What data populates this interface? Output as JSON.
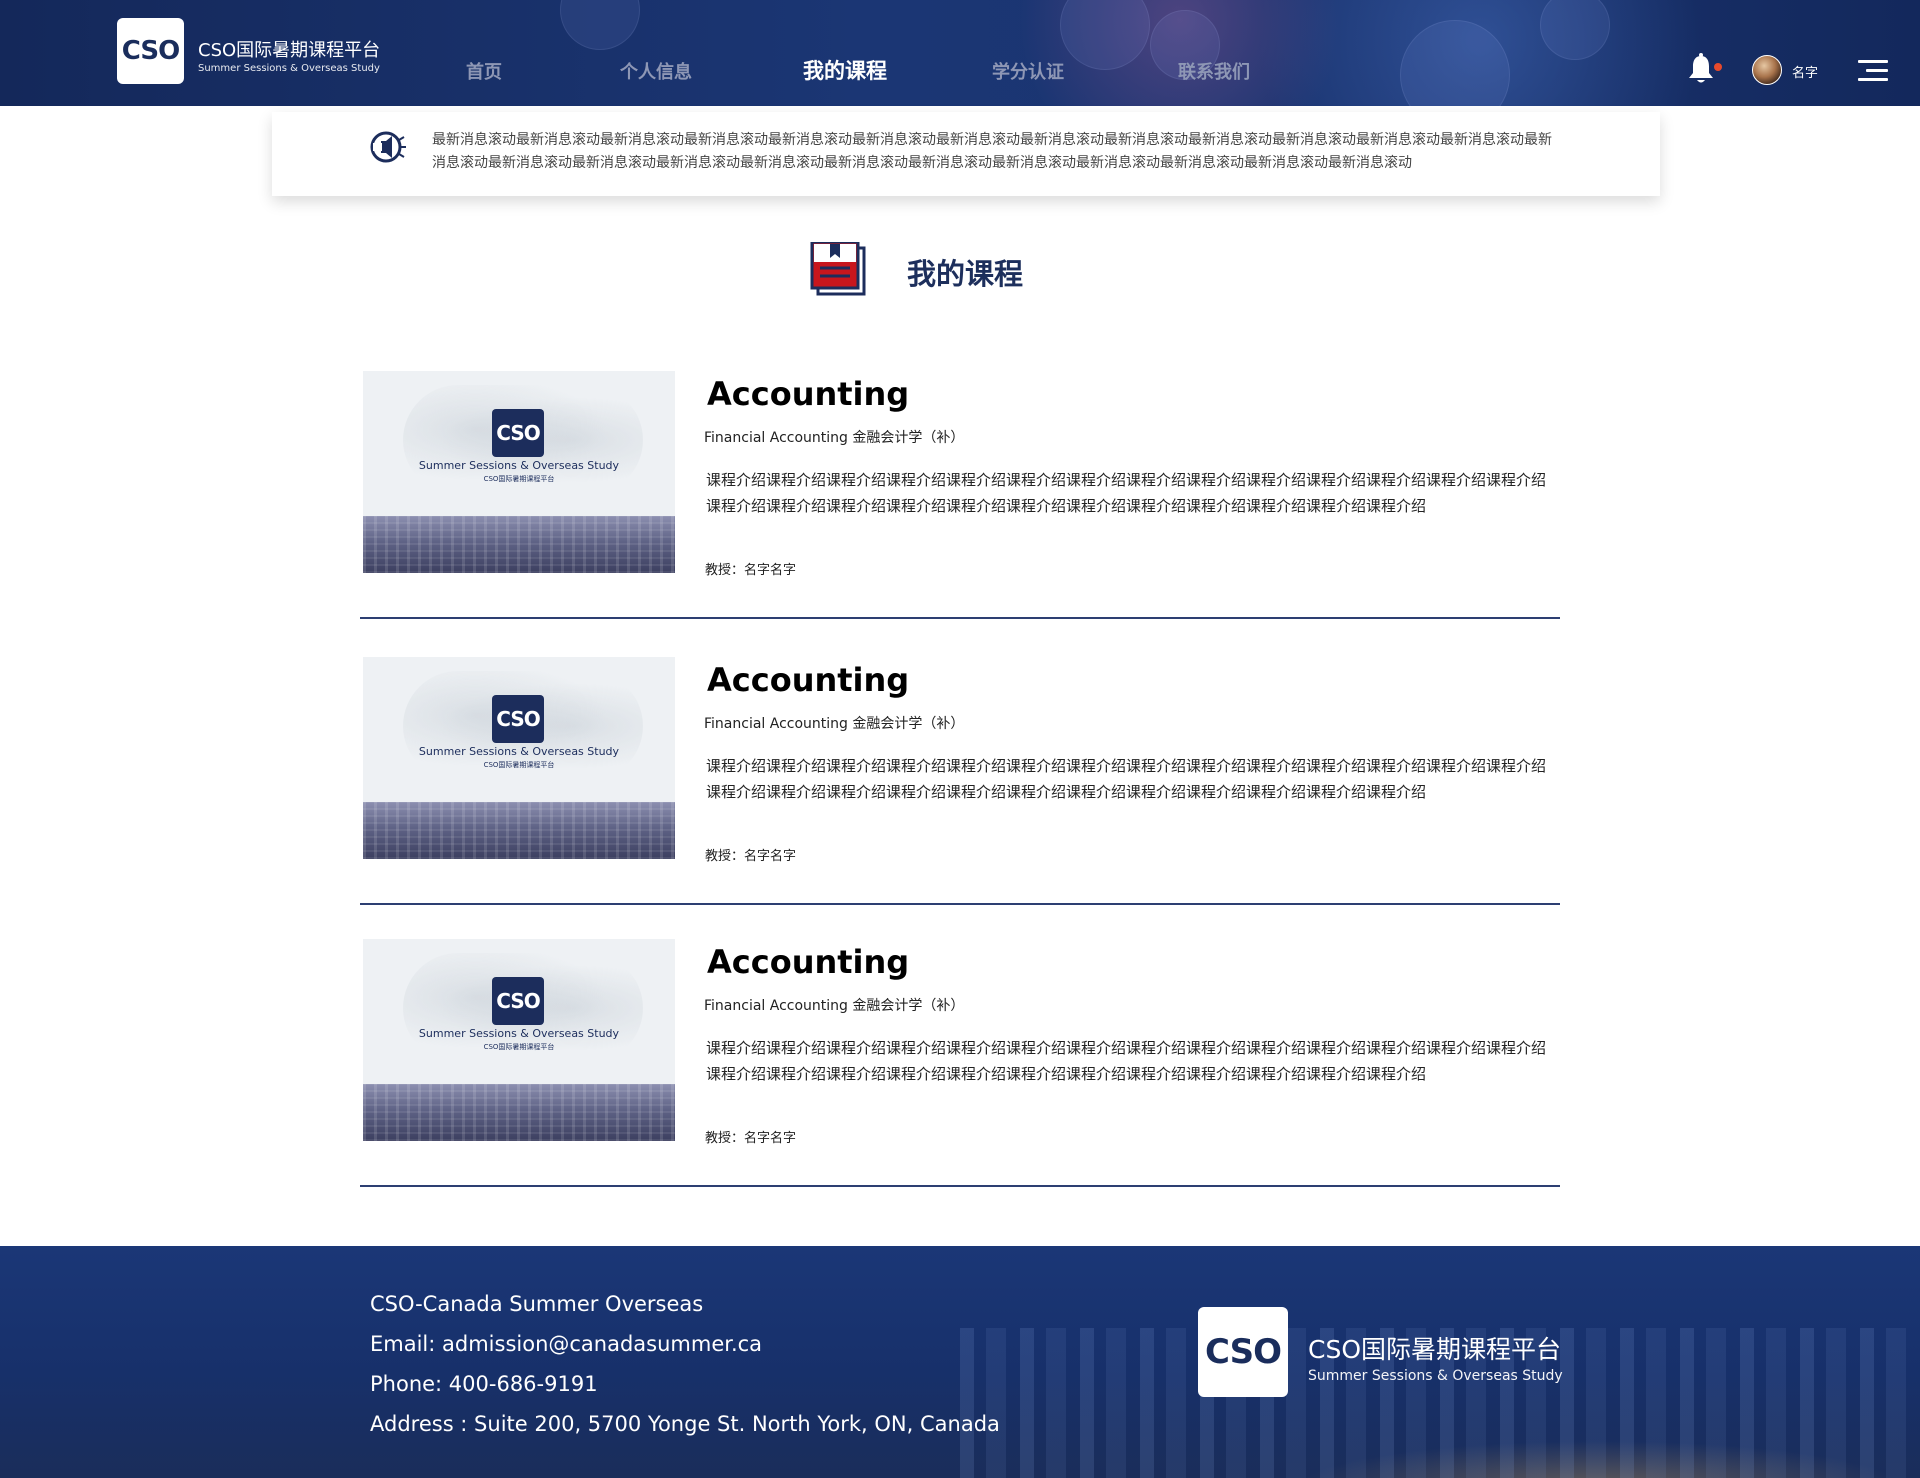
{
  "header": {
    "logo_mark": "CSO",
    "logo_title": "CSO国际暑期课程平台",
    "logo_subtitle": "Summer Sessions & Overseas Study",
    "nav": [
      {
        "label": "首页",
        "active": false
      },
      {
        "label": "个人信息",
        "active": false
      },
      {
        "label": "我的课程",
        "active": true
      },
      {
        "label": "学分认证",
        "active": false
      },
      {
        "label": "联系我们",
        "active": false
      }
    ],
    "user_name": "名字",
    "icons": {
      "bell": "bell-icon",
      "menu": "menu-icon"
    }
  },
  "ticker": {
    "icon": "speaker-icon",
    "text": "最新消息滚动最新消息滚动最新消息滚动最新消息滚动最新消息滚动最新消息滚动最新消息滚动最新消息滚动最新消息滚动最新消息滚动最新消息滚动最新消息滚动最新消息滚动最新消息滚动最新消息滚动最新消息滚动最新消息滚动最新消息滚动最新消息滚动最新消息滚动最新消息滚动最新消息滚动最新消息滚动最新消息滚动最新消息滚动"
  },
  "section": {
    "title": "我的课程",
    "icon": "course-book-icon"
  },
  "courses": [
    {
      "thumb_mark": "CSO",
      "thumb_line1": "Summer Sessions & Overseas Study",
      "thumb_line2": "CSO国际暑期课程平台",
      "title": "Accounting",
      "subtitle": "Financial Accounting 金融会计学（补）",
      "description": "课程介绍课程介绍课程介绍课程介绍课程介绍课程介绍课程介绍课程介绍课程介绍课程介绍课程介绍课程介绍课程介绍课程介绍课程介绍课程介绍课程介绍课程介绍课程介绍课程介绍课程介绍课程介绍课程介绍课程介绍课程介绍课程介绍",
      "professor": "教授：名字名字"
    },
    {
      "thumb_mark": "CSO",
      "thumb_line1": "Summer Sessions & Overseas Study",
      "thumb_line2": "CSO国际暑期课程平台",
      "title": "Accounting",
      "subtitle": "Financial Accounting 金融会计学（补）",
      "description": "课程介绍课程介绍课程介绍课程介绍课程介绍课程介绍课程介绍课程介绍课程介绍课程介绍课程介绍课程介绍课程介绍课程介绍课程介绍课程介绍课程介绍课程介绍课程介绍课程介绍课程介绍课程介绍课程介绍课程介绍课程介绍课程介绍",
      "professor": "教授：名字名字"
    },
    {
      "thumb_mark": "CSO",
      "thumb_line1": "Summer Sessions & Overseas Study",
      "thumb_line2": "CSO国际暑期课程平台",
      "title": "Accounting",
      "subtitle": "Financial Accounting 金融会计学（补）",
      "description": "课程介绍课程介绍课程介绍课程介绍课程介绍课程介绍课程介绍课程介绍课程介绍课程介绍课程介绍课程介绍课程介绍课程介绍课程介绍课程介绍课程介绍课程介绍课程介绍课程介绍课程介绍课程介绍课程介绍课程介绍课程介绍课程介绍",
      "professor": "教授：名字名字"
    }
  ],
  "footer": {
    "lines": [
      "CSO-Canada Summer Overseas",
      "Email: admission@canadasummer.ca",
      "Phone: 400-686-9191",
      "Address : Suite 200, 5700 Yonge St. North York, ON, Canada"
    ],
    "logo_mark": "CSO",
    "logo_title": "CSO国际暑期课程平台",
    "logo_subtitle": "Summer Sessions & Overseas Study"
  },
  "colors": {
    "header_bg": "#1b3674",
    "nav_inactive": "#8e97b5",
    "accent_red": "#c8161d",
    "divider": "#2d3f72",
    "notification_dot": "#e84a2c"
  }
}
